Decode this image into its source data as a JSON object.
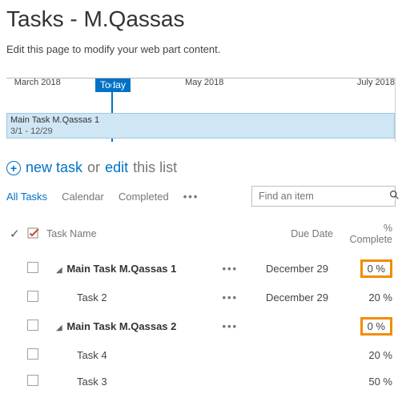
{
  "title": "Tasks - M.Qassas",
  "edit_hint": "Edit this page to modify your web part content.",
  "timeline": {
    "today_label": "Today",
    "today_percent": 27,
    "ticks": [
      {
        "label": "March 2018",
        "pos": 2
      },
      {
        "label": "May 2018",
        "pos": 46
      },
      {
        "label": "July 2018",
        "pos": 98
      }
    ],
    "bar": {
      "title": "Main Task M.Qassas 1",
      "range": "3/1 - 12/29",
      "width_pct": 100
    }
  },
  "toolbar": {
    "new_task": "new task",
    "or": "or",
    "edit": "edit",
    "this_list": "this list"
  },
  "views": {
    "items": [
      "All Tasks",
      "Calendar",
      "Completed"
    ],
    "active": 0
  },
  "search": {
    "placeholder": "Find an item"
  },
  "columns": {
    "task_name": "Task Name",
    "due_date": "Due Date",
    "pct_complete": "% Complete"
  },
  "rows": [
    {
      "level": 0,
      "parent": true,
      "name": "Main Task M.Qassas 1",
      "due": "December 29",
      "pct": "0 %",
      "highlight": true,
      "show_dots": true
    },
    {
      "level": 1,
      "parent": false,
      "name": "Task 2",
      "due": "December 29",
      "pct": "20 %",
      "highlight": false,
      "show_dots": true
    },
    {
      "level": 0,
      "parent": true,
      "name": "Main Task M.Qassas 2",
      "due": "",
      "pct": "0 %",
      "highlight": true,
      "show_dots": true
    },
    {
      "level": 1,
      "parent": false,
      "name": "Task 4",
      "due": "",
      "pct": "20 %",
      "highlight": false,
      "show_dots": false
    },
    {
      "level": 1,
      "parent": false,
      "name": "Task 3",
      "due": "",
      "pct": "50 %",
      "highlight": false,
      "show_dots": false
    }
  ]
}
